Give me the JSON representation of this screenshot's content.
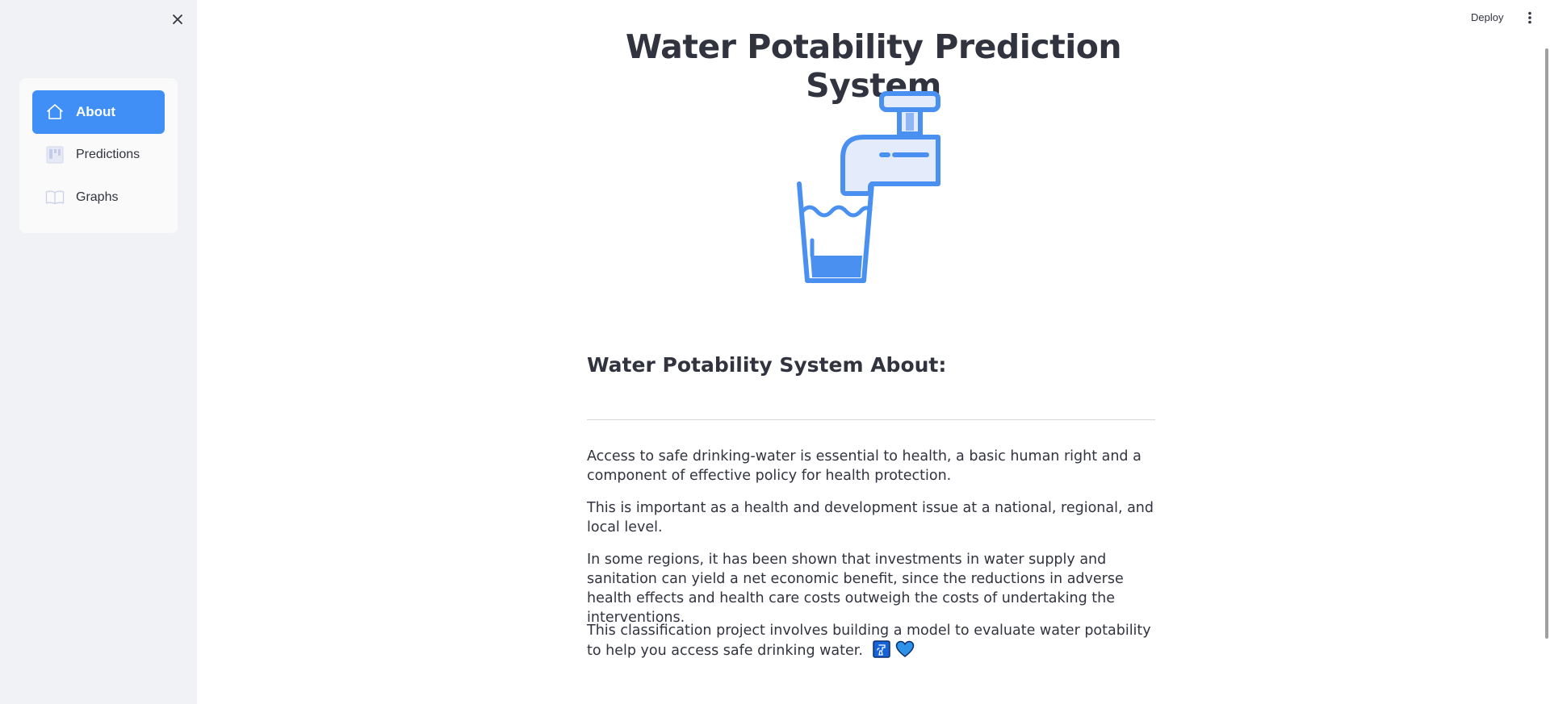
{
  "sidebar": {
    "nav": [
      {
        "label": "About",
        "icon": "house-icon",
        "active": true
      },
      {
        "label": "Predictions",
        "icon": "kanban-icon",
        "active": false
      },
      {
        "label": "Graphs",
        "icon": "book-icon",
        "active": false
      }
    ]
  },
  "header": {
    "deploy_label": "Deploy"
  },
  "main": {
    "title": "Water Potability Prediction System",
    "section_heading": "Water Potability System About:",
    "paragraphs": [
      "Access to safe drinking-water is essential to health, a basic human right and a component of effective policy for health protection.",
      "This is important as a health and development issue at a national, regional, and local level.",
      "In some regions, it has been shown that investments in water supply and sanitation can yield a net economic benefit, since the reductions in adverse health effects and health care costs outweigh the costs of undertaking the interventions.",
      "This classification project involves building a model to evaluate water potability to help you access safe drinking water."
    ],
    "trailing_emojis": [
      "potable-water-emoji",
      "blue-heart-emoji"
    ]
  },
  "colors": {
    "accent": "#3f8ff6",
    "sidebar_bg": "#f0f2f6",
    "text": "#31333f",
    "icon_blue": "#4a90f0",
    "icon_light": "#e4ebfa"
  }
}
